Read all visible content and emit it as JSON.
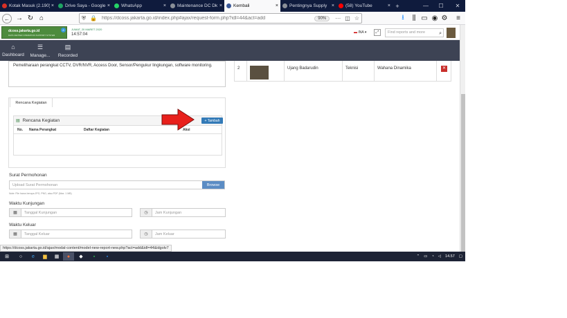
{
  "tabs": [
    {
      "label": "Kotak Masuk (2.190)",
      "color": "#d93025"
    },
    {
      "label": "Drive Saya - Google",
      "color": "#1fa463"
    },
    {
      "label": "WhatsApp",
      "color": "#25d366"
    },
    {
      "label": "Maintenance DC Dk",
      "color": "#8a8f98"
    },
    {
      "label": "Kembali",
      "color": "#3b5998",
      "active": true
    },
    {
      "label": "Pentingnya Supply",
      "color": "#8a8f98"
    },
    {
      "label": "(58) YouTube",
      "color": "#ff0000"
    }
  ],
  "browser": {
    "url": "https://dcoss.jakarta.go.id/index.php#ajax/request-form.php?idl=44&act=add",
    "zoom": "90%"
  },
  "app": {
    "logo_title": "dcoss.jakarta.go.id",
    "logo_sub": "DATA CENTER OPERATION SUPPORT SYSTEM",
    "badge": "8",
    "date": "JUMAT, 20 MARET 2020",
    "time": "14:57:04",
    "lang": "INA",
    "search_placeholder": "Find reports and more"
  },
  "nav": [
    {
      "label": "Dashboard",
      "icon": "⌂"
    },
    {
      "label": "Manage...",
      "icon": "☰"
    },
    {
      "label": "Recorded",
      "icon": "▤"
    }
  ],
  "form": {
    "description": "Pemeliharaan perangkat CCTV, DVR/NVR, Access Door, Sensor/Pengukur lingkungan, software monitoring.",
    "tab": "Rencana Kegiatan",
    "box_title": "Rencana Kegiatan",
    "add_button": "+ Tambah",
    "cols": [
      "No.",
      "Nama Perangkat",
      "Daftar Kegiatan",
      "Aksi"
    ],
    "surat_label": "Surat Permohonan",
    "surat_placeholder": "Upload Surat Permohonan",
    "browse": "Browse",
    "surat_note": "Note: File harus berupa JPG, PNG, atau PDF (Max. 1 MB)",
    "kunjungan_label": "Waktu Kunjungan",
    "tgl_kunjungan": "Tanggal Kunjungan",
    "jam_kunjungan": "Jam Kunjungan",
    "keluar_label": "Waktu Keluar",
    "tgl_keluar": "Tanggal Keluar",
    "jam_keluar": "Jam Keluar"
  },
  "visitors": [
    {
      "no": "2",
      "name": "Ujang Badarudin",
      "role": "Teknisi",
      "company": "Wahana Dinamika"
    }
  ],
  "status_url": "https://dcoss.jakarta.go.id/ajax/modal-content/model-new-report-new.php?act=add&idl=44&idgolv7",
  "tray": {
    "time": "14.57"
  }
}
